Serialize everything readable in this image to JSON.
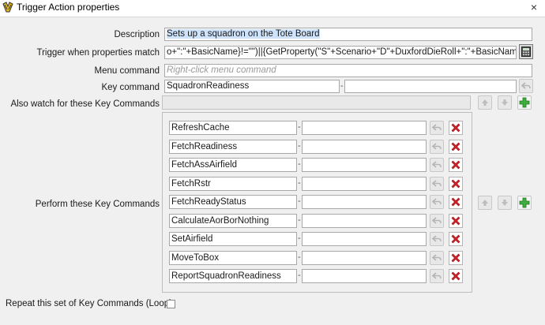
{
  "window": {
    "title": "Trigger Action properties",
    "close_label": "×"
  },
  "form": {
    "description": {
      "label": "Description",
      "value": "Sets up a squadron on the Tote Board"
    },
    "trigger": {
      "label": "Trigger when properties match",
      "value": "o+\":\"+BasicName}!=\"\")||{GetProperty(\"S\"+Scenario+\"D\"+DuxfordDieRoll+\":\"+BasicName}!=\"\")}"
    },
    "menu_command": {
      "label": "Menu command",
      "placeholder": "Right-click menu command"
    },
    "key_command": {
      "label": "Key command",
      "value": "SquadronReadiness",
      "second_value": ""
    },
    "also_watch": {
      "label": "Also watch for these Key Commands"
    },
    "perform": {
      "label": "Perform these Key Commands"
    },
    "repeat": {
      "label": "Repeat this set of Key Commands (Loop)",
      "checked": false
    }
  },
  "key_commands": [
    "RefreshCache",
    "FetchReadiness",
    "FetchAssAirfield",
    "FetchRstr",
    "FetchReadyStatus",
    "CalculateAorBorNothing",
    "SetAirfield",
    "MoveToBox",
    "ReportSquadronReadiness"
  ],
  "icons": {
    "title": "vassal-logo-icon",
    "calculator": "calculator-icon",
    "undo": "undo-arrow-icon",
    "up": "arrow-up-icon",
    "down": "arrow-down-icon",
    "add": "plus-icon",
    "delete": "red-x-icon"
  },
  "colors": {
    "delete": "#d6232a",
    "add": "#2f9e2f",
    "selection": "#cfe3fb",
    "background": "#f0f0f0"
  }
}
